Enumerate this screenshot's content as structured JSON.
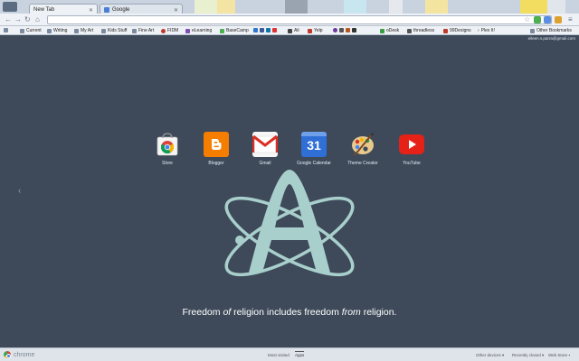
{
  "tabs": [
    {
      "label": "New Tab",
      "active": true
    },
    {
      "label": "Google",
      "active": false
    }
  ],
  "omnibox": {
    "value": "",
    "placeholder": ""
  },
  "bookmarks": [
    {
      "label": "Current",
      "color": "#7a8aa0"
    },
    {
      "label": "Writing",
      "color": "#7a8aa0"
    },
    {
      "label": "My Art",
      "color": "#7a8aa0"
    },
    {
      "label": "Kids Stuff",
      "color": "#7a8aa0"
    },
    {
      "label": "Fine Art",
      "color": "#7a8aa0"
    },
    {
      "label": "FIDM",
      "color": "#c0392b"
    },
    {
      "label": "eLearning",
      "color": "#7d4fb0"
    },
    {
      "label": "BaseCamp",
      "color": "#4caf50"
    },
    {
      "label": "Ali",
      "color": "#444444"
    },
    {
      "label": "Yelp",
      "color": "#c0392b"
    },
    {
      "label": "oDesk",
      "color": "#3a9d46"
    },
    {
      "label": "threadless",
      "color": "#555555"
    },
    {
      "label": "99Designs",
      "color": "#c0392b"
    },
    {
      "label": "Plex It!",
      "color": "#555555"
    }
  ],
  "other_bookmarks": "Other Bookmarks",
  "account_email": "eileen.s.parra@gmail.com",
  "apps": [
    {
      "label": "Store",
      "icon": "chrome-store-icon"
    },
    {
      "label": "Blogger",
      "icon": "blogger-icon"
    },
    {
      "label": "Gmail",
      "icon": "gmail-icon"
    },
    {
      "label": "Google Calendar",
      "icon": "calendar-icon",
      "day": "31"
    },
    {
      "label": "Theme Creator",
      "icon": "palette-icon"
    },
    {
      "label": "YouTube",
      "icon": "youtube-icon"
    }
  ],
  "tagline": {
    "part1": "Freedom ",
    "part2": "of",
    "part3": " religion includes freedom ",
    "part4": "from",
    "part5": " religion."
  },
  "footer": {
    "brand": "chrome",
    "tab_most_visited": "Most visited",
    "tab_apps": "Apps",
    "other_devices": "Other devices",
    "recently_closed": "Recently closed",
    "web_store": "Web Store"
  },
  "colors": {
    "background": "#3e4a5a",
    "symbol": "#a9cfcc"
  }
}
